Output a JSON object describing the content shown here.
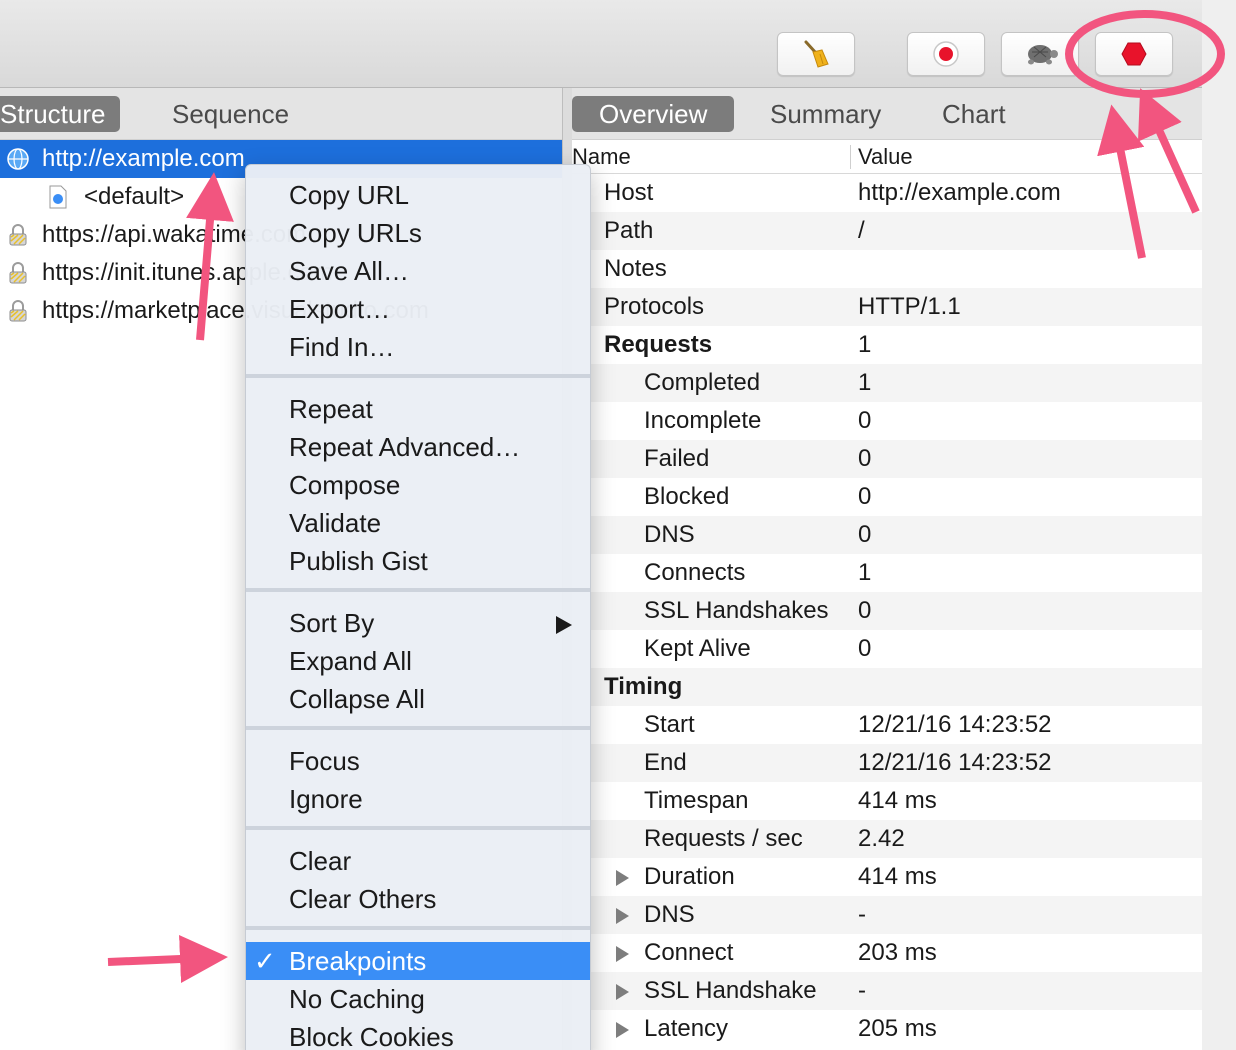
{
  "toolbar": {
    "buttons": [
      {
        "name": "clear-button",
        "icon": "broom-icon"
      },
      {
        "name": "record-button",
        "icon": "record-icon"
      },
      {
        "name": "throttle-button",
        "icon": "turtle-icon"
      },
      {
        "name": "breakpoints-button",
        "icon": "stop-hexagon-icon"
      }
    ]
  },
  "left": {
    "tabs": [
      {
        "label": "Structure",
        "active": true
      },
      {
        "label": "Sequence",
        "active": false
      }
    ],
    "tree": [
      {
        "label": "http://example.com",
        "icon": "globe-icon",
        "selected": true
      },
      {
        "label": "<default>",
        "icon": "document-icon",
        "selected": false
      },
      {
        "label": "https://api.wakatime.com",
        "icon": "lock-icon",
        "selected": false
      },
      {
        "label": "https://init.itunes.apple.com",
        "icon": "lock-icon",
        "selected": false
      },
      {
        "label": "https://marketplace.visualstudio.com",
        "icon": "lock-icon",
        "selected": false
      }
    ]
  },
  "right": {
    "tabs": [
      {
        "label": "Overview",
        "active": true
      },
      {
        "label": "Summary",
        "active": false
      },
      {
        "label": "Chart",
        "active": false
      }
    ],
    "columns": {
      "name": "Name",
      "value": "Value"
    },
    "rows": [
      {
        "name": "Host",
        "value": "http://example.com",
        "indent": 1
      },
      {
        "name": "Path",
        "value": "/",
        "indent": 1
      },
      {
        "name": "Notes",
        "value": "",
        "indent": 1
      },
      {
        "name": "Protocols",
        "value": "HTTP/1.1",
        "indent": 1
      },
      {
        "name": "Requests",
        "value": "1",
        "indent": 1,
        "bold": true
      },
      {
        "name": "Completed",
        "value": "1",
        "indent": 2
      },
      {
        "name": "Incomplete",
        "value": "0",
        "indent": 2
      },
      {
        "name": "Failed",
        "value": "0",
        "indent": 2
      },
      {
        "name": "Blocked",
        "value": "0",
        "indent": 2
      },
      {
        "name": "DNS",
        "value": "0",
        "indent": 2
      },
      {
        "name": "Connects",
        "value": "1",
        "indent": 2
      },
      {
        "name": "SSL Handshakes",
        "value": "0",
        "indent": 2
      },
      {
        "name": "Kept Alive",
        "value": "0",
        "indent": 2
      },
      {
        "name": "Timing",
        "value": "",
        "indent": 1,
        "bold": true
      },
      {
        "name": "Start",
        "value": "12/21/16 14:23:52",
        "indent": 2
      },
      {
        "name": "End",
        "value": "12/21/16 14:23:52",
        "indent": 2
      },
      {
        "name": "Timespan",
        "value": "414 ms",
        "indent": 2
      },
      {
        "name": "Requests / sec",
        "value": "2.42",
        "indent": 2
      },
      {
        "name": "Duration",
        "value": "414 ms",
        "indent": 2,
        "expandable": true
      },
      {
        "name": "DNS",
        "value": "-",
        "indent": 2,
        "expandable": true
      },
      {
        "name": "Connect",
        "value": "203 ms",
        "indent": 2,
        "expandable": true
      },
      {
        "name": "SSL Handshake",
        "value": "-",
        "indent": 2,
        "expandable": true
      },
      {
        "name": "Latency",
        "value": "205 ms",
        "indent": 2,
        "expandable": true
      }
    ]
  },
  "context_menu": {
    "groups": [
      [
        {
          "label": "Copy URL"
        },
        {
          "label": "Copy URLs"
        },
        {
          "label": "Save All…"
        },
        {
          "label": "Export…"
        },
        {
          "label": "Find In…"
        }
      ],
      [
        {
          "label": "Repeat"
        },
        {
          "label": "Repeat Advanced…"
        },
        {
          "label": "Compose"
        },
        {
          "label": "Validate"
        },
        {
          "label": "Publish Gist"
        }
      ],
      [
        {
          "label": "Sort By",
          "submenu": true
        },
        {
          "label": "Expand All"
        },
        {
          "label": "Collapse All"
        }
      ],
      [
        {
          "label": "Focus"
        },
        {
          "label": "Ignore"
        }
      ],
      [
        {
          "label": "Clear"
        },
        {
          "label": "Clear Others"
        }
      ],
      [
        {
          "label": "Breakpoints",
          "checked": true,
          "highlighted": true
        },
        {
          "label": "No Caching"
        },
        {
          "label": "Block Cookies"
        }
      ]
    ],
    "check_glyph": "✓"
  },
  "annotation_color": "#f2557f"
}
